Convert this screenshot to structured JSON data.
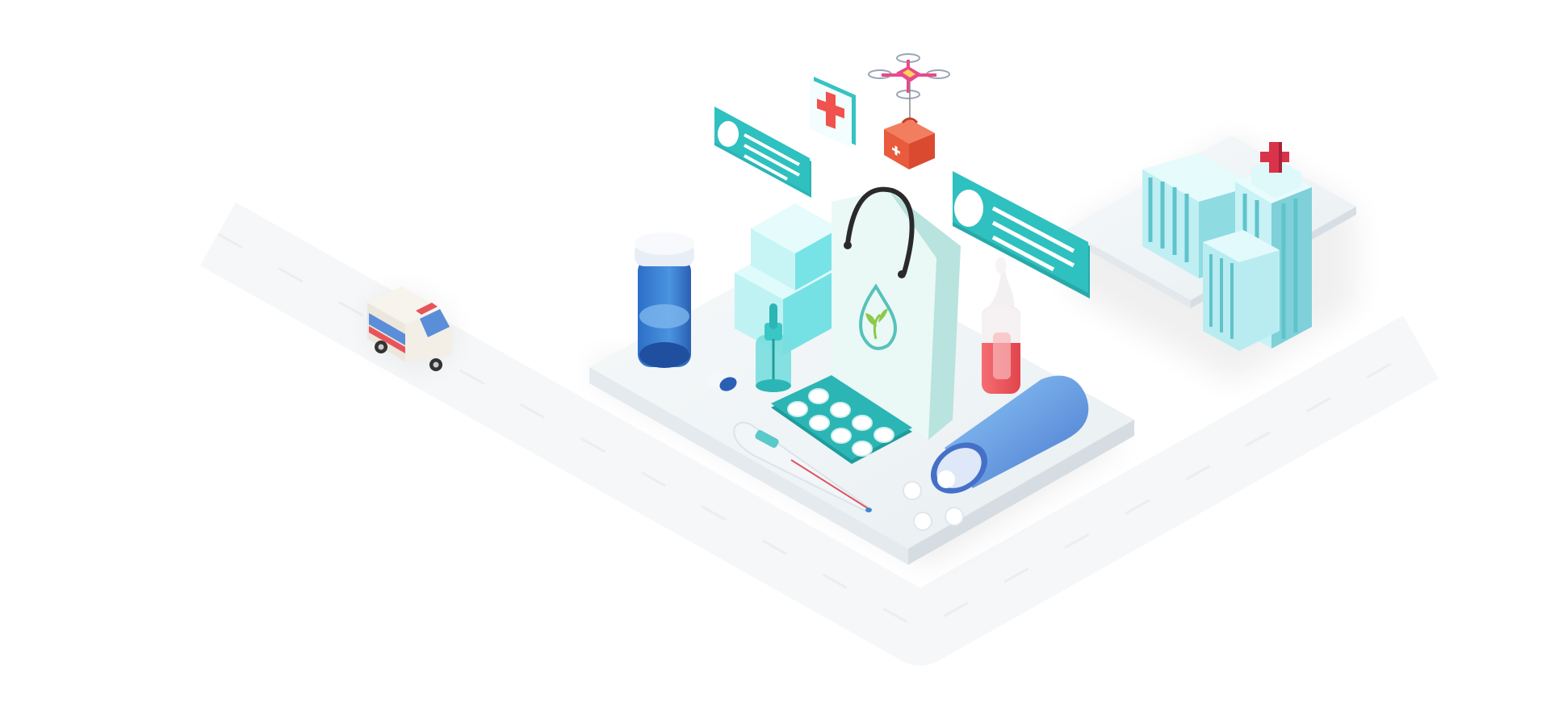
{
  "scene": {
    "description_free": true
  },
  "colors": {
    "background": "#ffffff",
    "road": "#f4f6f7",
    "road_dash": "#e4e8ea",
    "platform_top": "#f3f6f8",
    "platform_side": "#e2e8ec",
    "teal": "#2cb5b5",
    "teal_dark": "#1f9c9c",
    "teal_light": "#a6ecec",
    "mint_box": "#c7f5f5",
    "mint_box_side": "#78e3e6",
    "blue_bottle": "#3f86d6",
    "blue_bottle_dark": "#2a5fb4",
    "blue_cap": "#e6ecf5",
    "red_cross": "#f0524d",
    "red_bottle": "#f05a5f",
    "pink_drone": "#e84a8c",
    "building": "#bfeff3",
    "building_stripe": "#5fc3cc",
    "building_side": "#8fdbe2",
    "hospital_cross": "#d9334a",
    "bag": "#e5f5f3",
    "bag_side": "#b8e3de",
    "bag_handle": "#2a2a2a",
    "leaf": "#8cc94a",
    "pill_white": "#ffffff",
    "ambulance_body": "#f7f4ee",
    "ambulance_stripe": "#e8545b",
    "ambulance_window": "#5b8ed8"
  },
  "icons": [
    "ambulance-icon",
    "drone-icon",
    "first-aid-kit-icon",
    "medical-cross-card-icon",
    "profile-card-icon",
    "pill-bottle-icon",
    "medicine-box-icon",
    "shopping-bag-icon",
    "dropper-bottle-icon",
    "eye-drop-bottle-icon",
    "blister-pack-icon",
    "thermometer-icon",
    "spilled-pill-bottle-icon",
    "hospital-building-icon"
  ]
}
